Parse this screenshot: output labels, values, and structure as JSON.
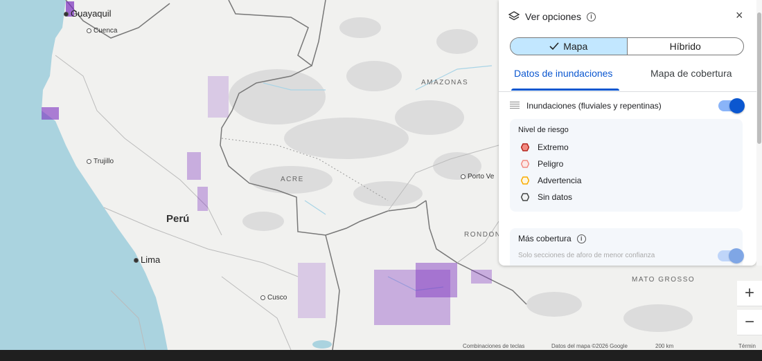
{
  "map": {
    "labels": {
      "guayaquil": "Guayaquil",
      "cuenca": "Cuenca",
      "trujillo": "Trujillo",
      "peru": "Perú",
      "lima": "Lima",
      "cusco": "Cusco",
      "amazonas": "AMAZONAS",
      "acre": "ACRE",
      "porto_velho": "Porto Ve",
      "rondonia": "RONDON",
      "mato_grosso": "MATO GROSSO"
    },
    "attribution": {
      "shortcuts": "Combinaciones de teclas",
      "data": "Datos del mapa ©2026 Google",
      "scale": "200 km",
      "terms": "Términ"
    },
    "zoom_in": "+",
    "zoom_out": "−"
  },
  "panel": {
    "title": "Ver opciones",
    "close": "×",
    "view_mode": {
      "map": "Mapa",
      "hybrid": "Híbrido",
      "selected": "Mapa"
    },
    "tabs": {
      "flood_data": "Datos de inundaciones",
      "coverage_map": "Mapa de cobertura",
      "active": "Datos de inundaciones"
    },
    "layer": {
      "label": "Inundaciones (fluviales y repentinas)",
      "enabled": true
    },
    "risk": {
      "title": "Nivel de riesgo",
      "items": [
        {
          "label": "Extremo",
          "color": "#b3261e"
        },
        {
          "label": "Peligro",
          "color": "#f28b82"
        },
        {
          "label": "Advertencia",
          "color": "#f9ab00"
        },
        {
          "label": "Sin datos",
          "color": "#444746"
        }
      ]
    },
    "more": {
      "title": "Más cobertura",
      "subtitle": "Solo secciones de aforo de menor confianza",
      "enabled": true
    }
  },
  "colors": {
    "accent": "#0b57d0",
    "ocean": "#aad3df",
    "flood": "#7b2fbf"
  }
}
